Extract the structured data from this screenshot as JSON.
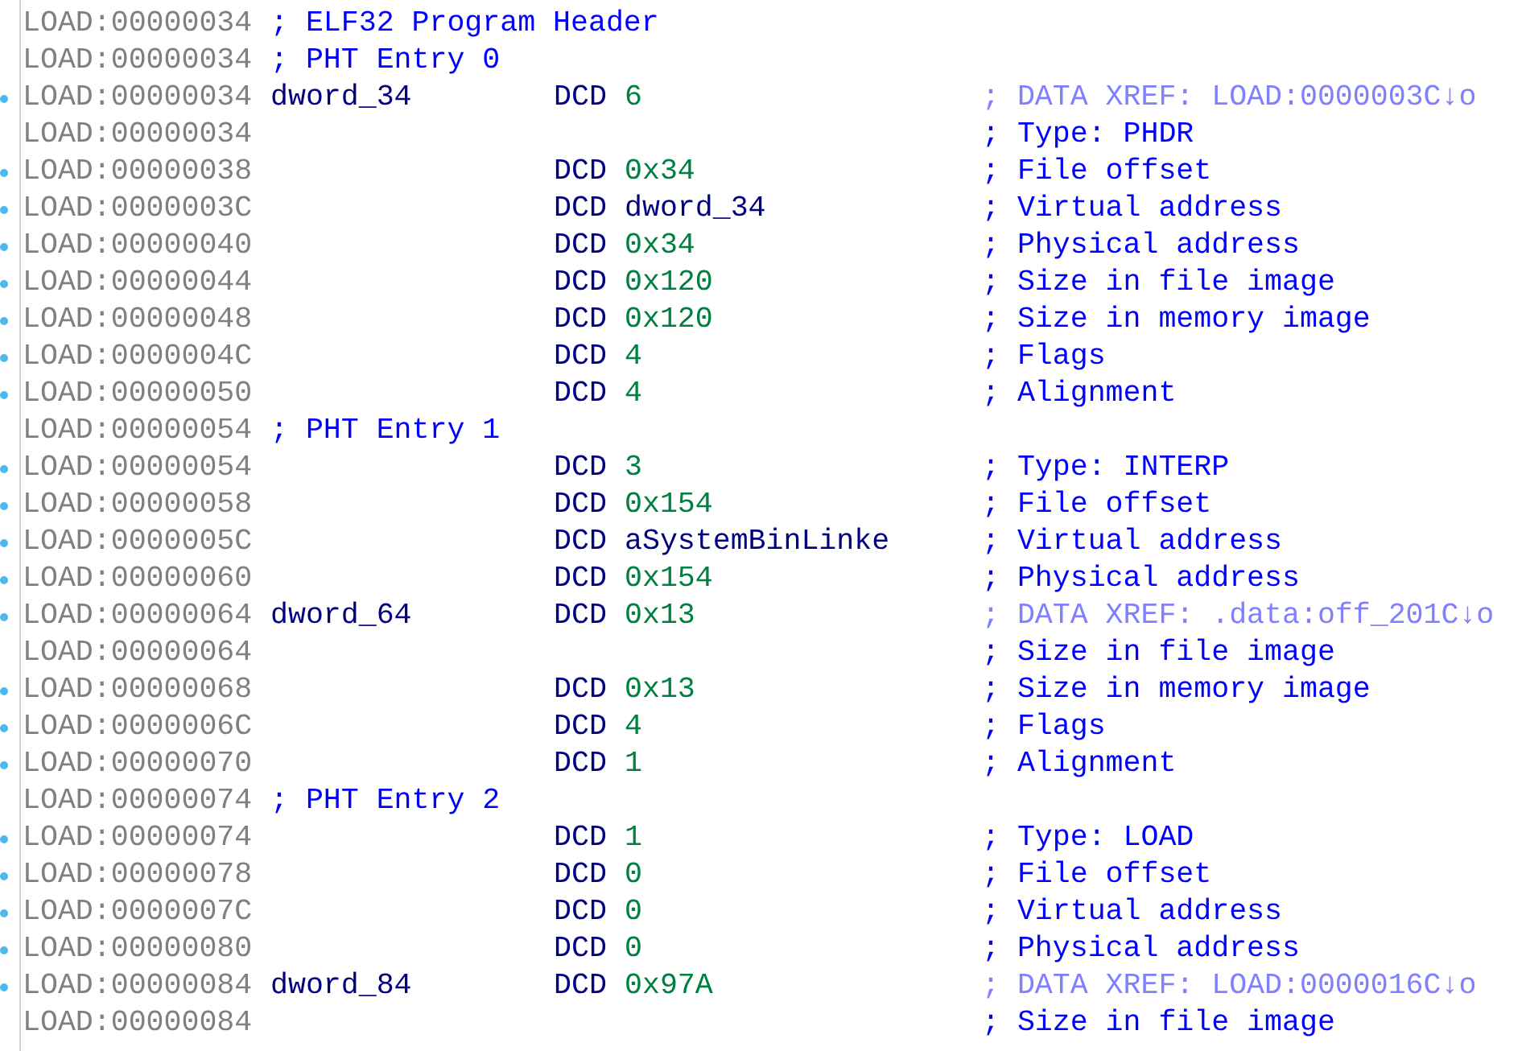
{
  "listing": {
    "rows": [
      {
        "kind": "header",
        "address": "LOAD:00000034",
        "comment": "; ELF32 Program Header"
      },
      {
        "kind": "header",
        "address": "LOAD:00000034",
        "comment": "; PHT Entry 0"
      },
      {
        "kind": "item",
        "address": "LOAD:00000034",
        "label": "dword_34",
        "directive": "DCD",
        "operand": {
          "kind": "number",
          "text": "6"
        },
        "comment": {
          "kind": "xref",
          "text": "; DATA XREF: LOAD:0000003C↓o"
        }
      },
      {
        "kind": "continuation",
        "address": "LOAD:00000034",
        "comment": {
          "kind": "note",
          "text": "; Type: PHDR"
        }
      },
      {
        "kind": "item",
        "address": "LOAD:00000038",
        "directive": "DCD",
        "operand": {
          "kind": "number",
          "text": "0x34"
        },
        "comment": {
          "kind": "note",
          "text": "; File offset"
        }
      },
      {
        "kind": "item",
        "address": "LOAD:0000003C",
        "directive": "DCD",
        "operand": {
          "kind": "name",
          "text": "dword_34"
        },
        "comment": {
          "kind": "note",
          "text": "; Virtual address"
        }
      },
      {
        "kind": "item",
        "address": "LOAD:00000040",
        "directive": "DCD",
        "operand": {
          "kind": "number",
          "text": "0x34"
        },
        "comment": {
          "kind": "note",
          "text": "; Physical address"
        }
      },
      {
        "kind": "item",
        "address": "LOAD:00000044",
        "directive": "DCD",
        "operand": {
          "kind": "number",
          "text": "0x120"
        },
        "comment": {
          "kind": "note",
          "text": "; Size in file image"
        }
      },
      {
        "kind": "item",
        "address": "LOAD:00000048",
        "directive": "DCD",
        "operand": {
          "kind": "number",
          "text": "0x120"
        },
        "comment": {
          "kind": "note",
          "text": "; Size in memory image"
        }
      },
      {
        "kind": "item",
        "address": "LOAD:0000004C",
        "directive": "DCD",
        "operand": {
          "kind": "number",
          "text": "4"
        },
        "comment": {
          "kind": "note",
          "text": "; Flags"
        }
      },
      {
        "kind": "item",
        "address": "LOAD:00000050",
        "directive": "DCD",
        "operand": {
          "kind": "number",
          "text": "4"
        },
        "comment": {
          "kind": "note",
          "text": "; Alignment"
        }
      },
      {
        "kind": "header",
        "address": "LOAD:00000054",
        "comment": "; PHT Entry 1"
      },
      {
        "kind": "item",
        "address": "LOAD:00000054",
        "directive": "DCD",
        "operand": {
          "kind": "number",
          "text": "3"
        },
        "comment": {
          "kind": "note",
          "text": "; Type: INTERP"
        }
      },
      {
        "kind": "item",
        "address": "LOAD:00000058",
        "directive": "DCD",
        "operand": {
          "kind": "number",
          "text": "0x154"
        },
        "comment": {
          "kind": "note",
          "text": "; File offset"
        }
      },
      {
        "kind": "item",
        "address": "LOAD:0000005C",
        "directive": "DCD",
        "operand": {
          "kind": "name",
          "text": "aSystemBinLinke"
        },
        "comment": {
          "kind": "note",
          "text": "; Virtual address"
        }
      },
      {
        "kind": "item",
        "address": "LOAD:00000060",
        "directive": "DCD",
        "operand": {
          "kind": "number",
          "text": "0x154"
        },
        "comment": {
          "kind": "note",
          "text": "; Physical address"
        }
      },
      {
        "kind": "item",
        "address": "LOAD:00000064",
        "label": "dword_64",
        "directive": "DCD",
        "operand": {
          "kind": "number",
          "text": "0x13"
        },
        "comment": {
          "kind": "xref",
          "text": "; DATA XREF: .data:off_201C↓o"
        }
      },
      {
        "kind": "continuation",
        "address": "LOAD:00000064",
        "comment": {
          "kind": "note",
          "text": "; Size in file image"
        }
      },
      {
        "kind": "item",
        "address": "LOAD:00000068",
        "directive": "DCD",
        "operand": {
          "kind": "number",
          "text": "0x13"
        },
        "comment": {
          "kind": "note",
          "text": "; Size in memory image"
        }
      },
      {
        "kind": "item",
        "address": "LOAD:0000006C",
        "directive": "DCD",
        "operand": {
          "kind": "number",
          "text": "4"
        },
        "comment": {
          "kind": "note",
          "text": "; Flags"
        }
      },
      {
        "kind": "item",
        "address": "LOAD:00000070",
        "directive": "DCD",
        "operand": {
          "kind": "number",
          "text": "1"
        },
        "comment": {
          "kind": "note",
          "text": "; Alignment"
        }
      },
      {
        "kind": "header",
        "address": "LOAD:00000074",
        "comment": "; PHT Entry 2"
      },
      {
        "kind": "item",
        "address": "LOAD:00000074",
        "directive": "DCD",
        "operand": {
          "kind": "number",
          "text": "1"
        },
        "comment": {
          "kind": "note",
          "text": "; Type: LOAD"
        }
      },
      {
        "kind": "item",
        "address": "LOAD:00000078",
        "directive": "DCD",
        "operand": {
          "kind": "number",
          "text": "0"
        },
        "comment": {
          "kind": "note",
          "text": "; File offset"
        }
      },
      {
        "kind": "item",
        "address": "LOAD:0000007C",
        "directive": "DCD",
        "operand": {
          "kind": "number",
          "text": "0"
        },
        "comment": {
          "kind": "note",
          "text": "; Virtual address"
        }
      },
      {
        "kind": "item",
        "address": "LOAD:00000080",
        "directive": "DCD",
        "operand": {
          "kind": "number",
          "text": "0"
        },
        "comment": {
          "kind": "note",
          "text": "; Physical address"
        }
      },
      {
        "kind": "item",
        "address": "LOAD:00000084",
        "label": "dword_84",
        "directive": "DCD",
        "operand": {
          "kind": "number",
          "text": "0x97A"
        },
        "comment": {
          "kind": "xref",
          "text": "; DATA XREF: LOAD:0000016C↓o"
        }
      },
      {
        "kind": "continuation",
        "address": "LOAD:00000084",
        "comment": {
          "kind": "note",
          "text": "; Size in file image"
        }
      }
    ]
  }
}
